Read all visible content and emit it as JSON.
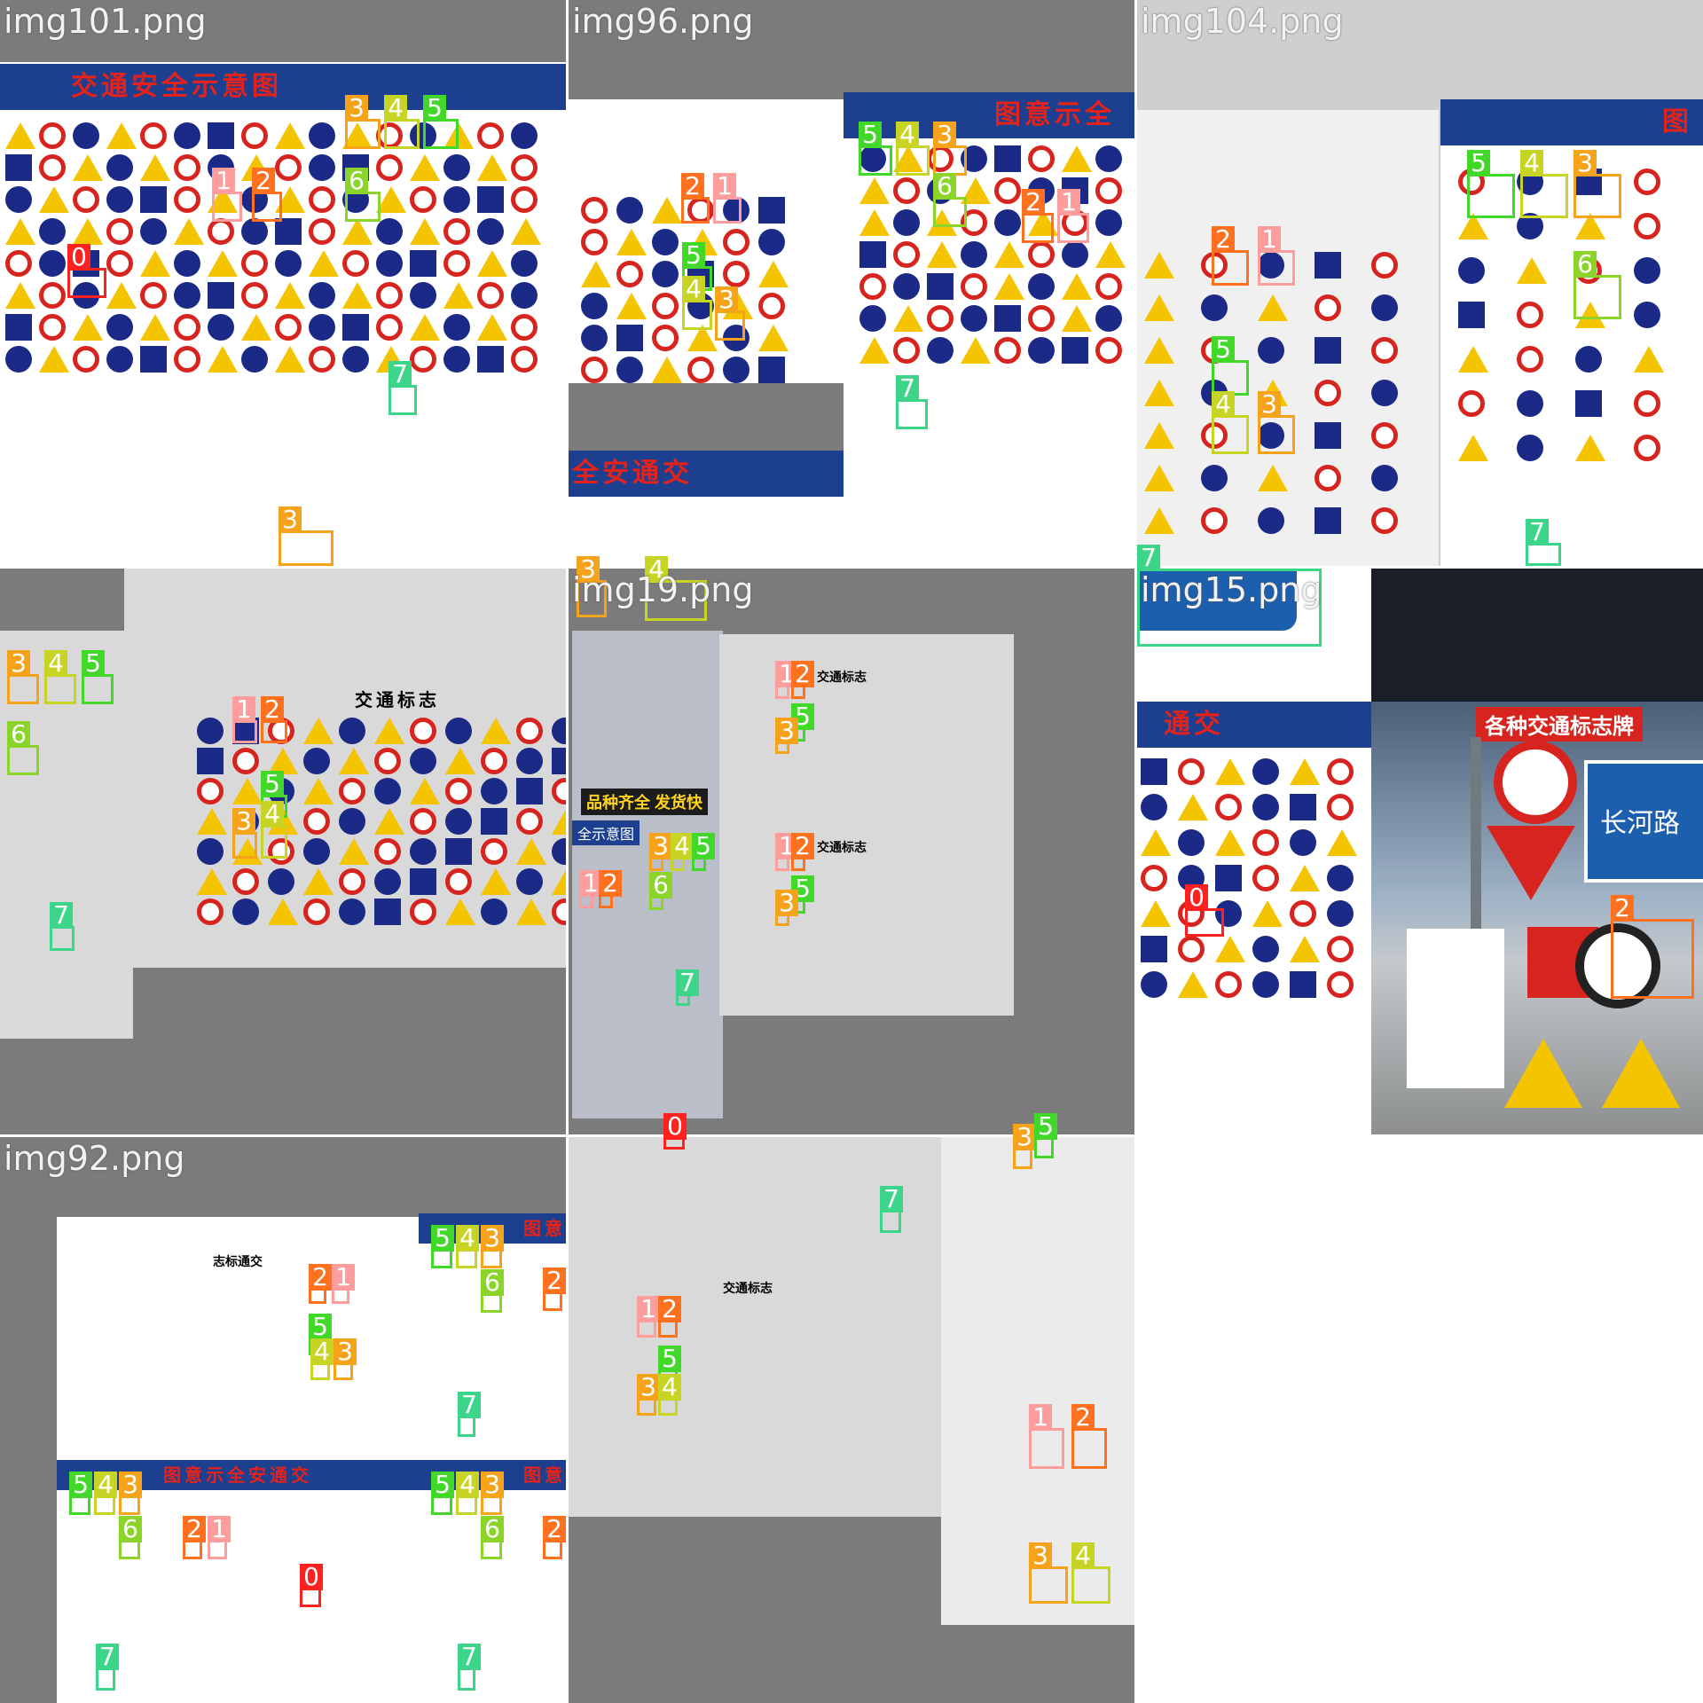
{
  "tiles": [
    {
      "id": "t1",
      "filename": "img101.png",
      "poster_title": "交通安全示意图"
    },
    {
      "id": "t2",
      "filename": "img96.png",
      "poster_title": "图意示全安",
      "sub_title": "全安通交"
    },
    {
      "id": "t3",
      "filename": "img104.png",
      "poster_title": "图"
    },
    {
      "id": "t4",
      "filename": "",
      "poster_title": "交通标志"
    },
    {
      "id": "t5",
      "filename": "img19.png",
      "poster_title": "交通标志",
      "banner1": "品种齐全 发货快",
      "banner2": "全示意图"
    },
    {
      "id": "t6",
      "filename": "img15.png",
      "poster_title": "通交",
      "street_banner": "各种交通标志牌",
      "road_sign": "长河路"
    },
    {
      "id": "t7",
      "filename": "img92.png",
      "poster_title": "志标通交",
      "banner": "图意示全安通交",
      "banner_right": "图意"
    },
    {
      "id": "t8",
      "filename": "",
      "poster_title": "交通标志"
    }
  ],
  "detection_labels": [
    "0",
    "1",
    "2",
    "3",
    "4",
    "5",
    "6",
    "7"
  ],
  "colors": {
    "class0": "#ff2020",
    "class1": "#ff9c9c",
    "class2": "#ff701f",
    "class3": "#f7a31a",
    "class4": "#c8d424",
    "class5": "#42d82a",
    "class6": "#8bd42a",
    "class7": "#3cd58a"
  }
}
